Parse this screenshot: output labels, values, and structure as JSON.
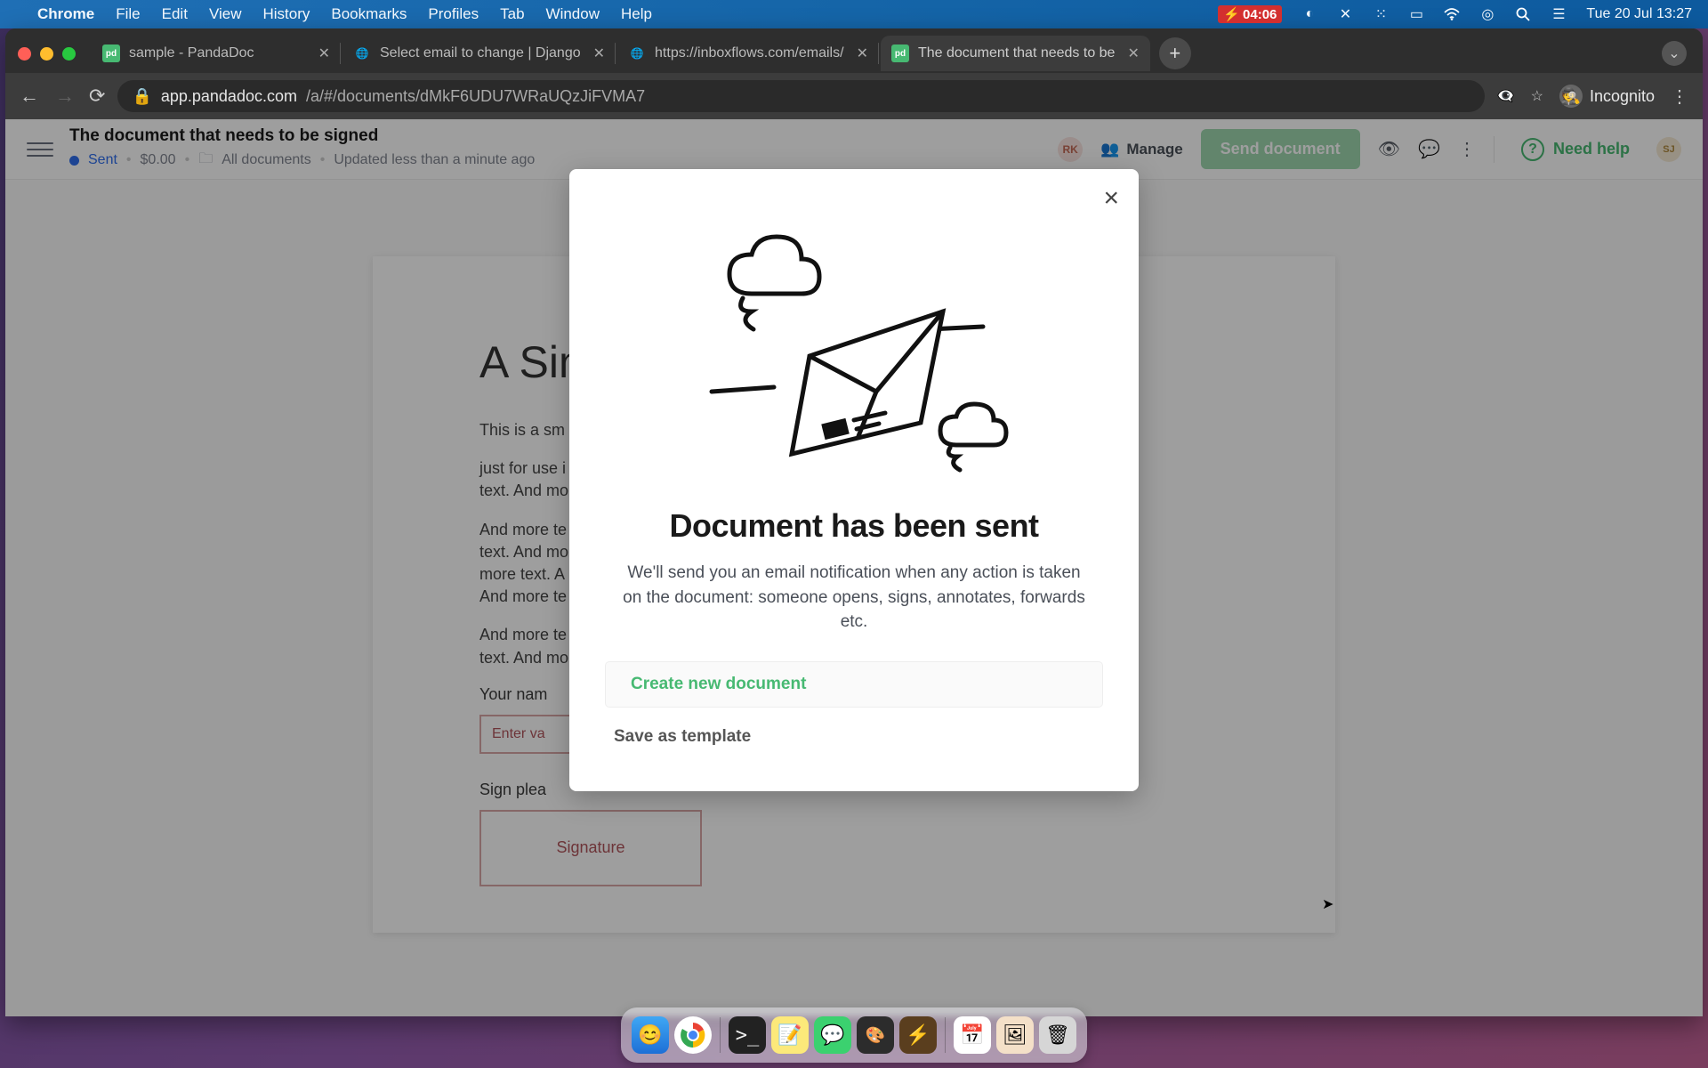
{
  "menubar": {
    "app_name": "Chrome",
    "items": [
      "File",
      "Edit",
      "View",
      "History",
      "Bookmarks",
      "Profiles",
      "Tab",
      "Window",
      "Help"
    ],
    "battery_time": "04:06",
    "datetime": "Tue 20 Jul  13:27"
  },
  "browser": {
    "tabs": [
      {
        "title": "sample - PandaDoc",
        "favicon": "pd",
        "active": false
      },
      {
        "title": "Select email to change | Django",
        "favicon": "globe",
        "active": false
      },
      {
        "title": "https://inboxflows.com/emails/",
        "favicon": "globe",
        "active": false
      },
      {
        "title": "The document that needs to be",
        "favicon": "pd",
        "active": true
      }
    ],
    "url_host": "app.pandadoc.com",
    "url_path": "/a/#/documents/dMkF6UDU7WRaUQzJiFVMA7",
    "incognito_label": "Incognito"
  },
  "app_header": {
    "doc_title": "The document that needs to be signed",
    "status": "Sent",
    "price": "$0.00",
    "folder": "All documents",
    "updated": "Updated less than a minute ago",
    "avatar_rk": "RK",
    "manage": "Manage",
    "send": "Send document",
    "need_help": "Need help",
    "avatar_sj": "SJ"
  },
  "document": {
    "heading": "A Sim",
    "p1": "This is a sm",
    "p2": "just for use i\ntext. And mo",
    "p3": "And more te\ntext. And mo\nmore text. A\nAnd more te",
    "p4": "And more te\ntext. And mo",
    "name_label": "Your nam",
    "name_placeholder": "Enter va",
    "sign_label": "Sign plea",
    "sign_placeholder": "Signature"
  },
  "modal": {
    "title": "Document has been sent",
    "description": "We'll send you an email notification when any action is taken on the document: someone opens, signs, annotates, forwards etc.",
    "primary": "Create new document",
    "secondary": "Save as template"
  },
  "dock": {
    "apps": [
      "finder",
      "chrome",
      "terminal",
      "notes",
      "whatsapp",
      "figma",
      "bolt",
      "calendar",
      "preview",
      "trash"
    ]
  }
}
